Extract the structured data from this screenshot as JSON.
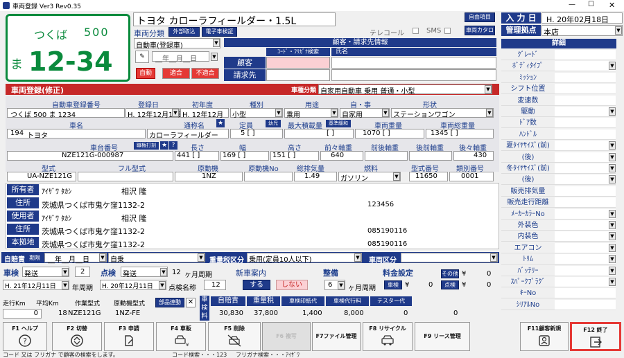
{
  "window": {
    "title": "車両登録 Ver3 Rev0.35",
    "min": "—",
    "max": "☐",
    "close": "✕"
  },
  "plate": {
    "region": "つくば",
    "class": "500",
    "kana": "ま",
    "number": "12-34"
  },
  "car_title": "トヨタ カローラフィールダー・1.5L",
  "top": {
    "vehicle_category_label": "車両分類",
    "external_import": "外部取込",
    "e_inspection": "電子車検証",
    "vehicle_type": "自動車(登録車)",
    "date_placeholder": "__年__月__日",
    "auto": "自動",
    "match": "適合",
    "mismatch": "不適合",
    "telecall": "テレコール",
    "sms": "SMS",
    "custom_btn": "自由項目",
    "catalog_btn": "車両カタログ",
    "customer_section": "顧客・請求先情報",
    "code_search": "ｺｰﾄﾞ・ﾌﾘｶﾞﾅ検索",
    "name_header": "氏名",
    "customer": "顧客",
    "billing": "請求先"
  },
  "entry": {
    "date_label": "入 力 日",
    "date_value": "H. 20年02月18日",
    "base_label": "管理拠点",
    "base_value": "本店"
  },
  "details": {
    "header": "詳細",
    "items": [
      "ｸﾞﾚｰﾄﾞ",
      "ﾎﾞﾃﾞｨﾀｲﾌﾟ",
      "ﾐｯｼｮﾝ",
      "シフト位置",
      "変速数",
      "駆動",
      "ﾄﾞｱ数",
      "ﾊﾝﾄﾞﾙ",
      "夏ﾀｲﾔｻｲｽﾞ(前)",
      "(後)",
      "冬ﾀｲﾔｻｲｽﾞ(前)",
      "(後)",
      "販売排気量",
      "販売走行距離",
      "ﾒｰｶｰｶﾗｰNo",
      "外装色",
      "内装色",
      "エアコン",
      "ﾄﾘﾑ",
      "ﾊﾞｯﾃﾘｰ",
      "ｽﾊﾟｰｸﾌﾟﾗｸﾞ",
      "ｷｰNo",
      "ｼﾘｱﾙNo"
    ]
  },
  "reg": {
    "header": "車両登録(修正)",
    "class_label": "車種分類",
    "class_value": "自家用自動車 乗用 普通・小型",
    "h_regno": "自動車登録番号",
    "h_regdate": "登録日",
    "h_first": "初年度",
    "h_kind": "種別",
    "h_use": "用途",
    "h_private": "自・事",
    "h_shape": "形状",
    "regno": "つくば 500 ま 1234",
    "regdate": "H. 12年12月12日",
    "first": "H. 12年12月",
    "kind": "小型",
    "use": "乗用",
    "private": "自家用",
    "shape": "ステーションワゴン",
    "h_maker": "車名",
    "h_common": "通称名",
    "h_capacity": "定員",
    "infant": "幼児",
    "h_maxload": "最大積載量",
    "base_easing": "基準緩和",
    "h_weight": "車両重量",
    "h_total": "車両総重量",
    "maker_code": "194",
    "maker": "トヨタ",
    "common": "カローラフィールダー",
    "capacity": "5 [ ]",
    "maxload": "[ ]",
    "weight": "1070 [ ]",
    "total": "1345 [ ]",
    "h_chassis": "車台番号",
    "stamp": "職権打刻",
    "h_len": "長さ",
    "h_wid": "幅",
    "h_hei": "高さ",
    "h_ff": "前々軸重",
    "h_fr": "前後軸重",
    "h_rf": "後前軸重",
    "h_rr": "後々軸重",
    "chassis": "NZE121G-000987",
    "len": "441 [ ]",
    "wid": "169 [ ]",
    "hei": "151 [ ]",
    "ff": "640",
    "rr": "430",
    "h_model": "型式",
    "h_fullmodel": "フル型式",
    "h_engine": "原動機",
    "h_engine_no": "原動機No",
    "h_disp": "総排気量",
    "h_fuel": "燃料",
    "h_model_no": "型式番号",
    "h_cat_no": "類別番号",
    "model": "UA-NZE121G",
    "engine": "1NZ",
    "disp": "1.49",
    "fuel": "ガソリン",
    "model_no": "11650",
    "cat_no": "0001"
  },
  "owner": {
    "owner_label": "所有者",
    "owner_kana": "ｱｲｻﾞﾜ ﾀｶｼ",
    "owner_name": "相沢 隆",
    "addr_label": "住所",
    "owner_addr": "茨城県つくば市鬼ケ窪1132-2",
    "owner_zip": "123456",
    "user_label": "使用者",
    "user_kana": "ｱｲｻﾞﾜ ﾀｶｼ",
    "user_name": "相沢 隆",
    "user_addr": "茨城県つくば市鬼ケ窪1132-2",
    "user_zip": "085190116",
    "base_label": "本拠地",
    "base_addr": "茨城県つくば市鬼ケ窪1132-2",
    "base_zip": "085190116"
  },
  "mid": {
    "insurance_label": "自賠責",
    "period": "期限",
    "period_date": "__年__月__日",
    "insurance_type": "自乗",
    "weight_tax_label": "重量税区分",
    "weight_tax_value": "乗用(定員10人以下)",
    "vehicle_zone_label": "車両区分"
  },
  "inspect": {
    "shaken": "車検",
    "shaken_type": "発送",
    "shaken_n": "2",
    "tenken": "点検",
    "tenken_type": "発送",
    "tenken_n": "12",
    "month_cycle": "ヶ月周期",
    "date1": "H. 21年12月11日",
    "year_cycle": "年周期",
    "date2": "H. 20年12月11日",
    "tenken_name": "点検名称",
    "tenken_name_value": "12",
    "newcar": "新車案内",
    "do": "する",
    "dont": "しない",
    "seibi": "整備",
    "seibi_n": "6",
    "seibi_cycle": "ヶ月周期",
    "fee": "料金設定",
    "other": "その他",
    "other_yen": "¥",
    "other_val": "0",
    "shaken_fee_btn": "車検",
    "yen": "¥",
    "shaken_fee": "0",
    "tenken_fee_btn": "点検",
    "tenken_fee": "0"
  },
  "bottom": {
    "mileage": "走行Km",
    "avg_km": "平均Km",
    "work_model": "作業型式",
    "engine_model": "原動機型式",
    "parts": "部品連動",
    "shaken_ryo": "車検料",
    "mileage_val": "0",
    "avg_val": "18",
    "work_val": "NZE121G",
    "engine_val": "1NZ-FE",
    "h_jibai": "自賠責",
    "h_juryo": "重量税",
    "h_inshi": "車検印紙代",
    "h_dairi": "車検代行料",
    "h_tester": "テスター代",
    "v_jibai": "30,830",
    "v_juryo": "37,800",
    "v_inshi": "1,400",
    "v_dairi": "8,000",
    "v_tester": "0",
    "v_extra": "0"
  },
  "fkeys": [
    "F1 ヘルプ",
    "F2 切替",
    "F3 申請",
    "F4 車販",
    "F5 削除",
    "F6 複写",
    "F7ファイル管理",
    "F8 リサイクル",
    "F9 リース管理",
    "F11顧客新規",
    "F12 終了"
  ],
  "status": {
    "hint1": "コード 又は フリガナ で顧客の検索をします。",
    "hint2": "コード検索・・・123",
    "hint3": "フリガナ検索・・・ｱｲｻﾞﾜ"
  },
  "colors": {
    "navy": "#1f3a8a",
    "red": "#c62828",
    "plate_green": "#0a8a3c",
    "highlight": "#e53935"
  }
}
